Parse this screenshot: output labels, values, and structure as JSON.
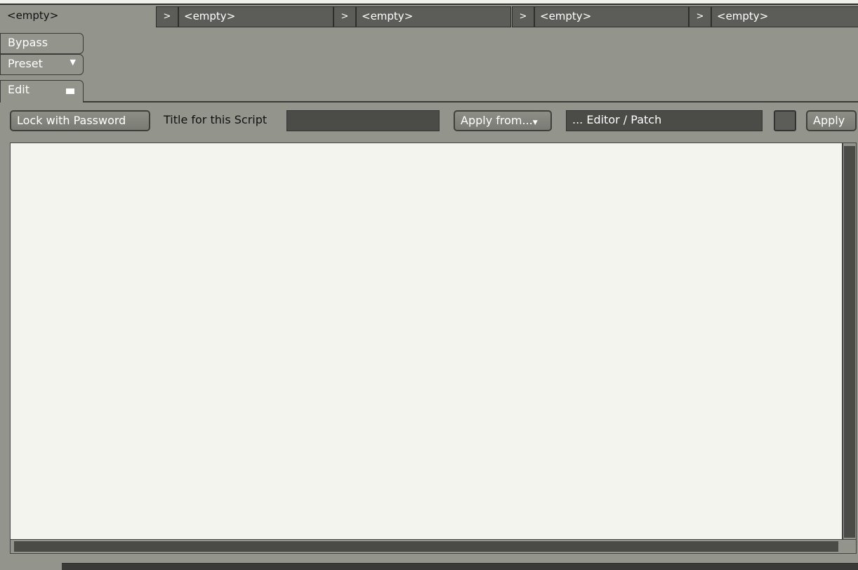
{
  "slots": [
    {
      "label": "<empty>",
      "active": true
    },
    {
      "label": "<empty>"
    },
    {
      "label": "<empty>"
    },
    {
      "label": "<empty>"
    },
    {
      "label": "<empty>"
    }
  ],
  "slot_arrow": ">",
  "side": {
    "bypass": "Bypass",
    "preset": "Preset",
    "edit": "Edit"
  },
  "toolbar": {
    "lock": "Lock with Password",
    "title_label": "Title for this Script",
    "title_value": "",
    "apply_from": "Apply from...",
    "source": "... Editor / Patch",
    "apply": "Apply"
  },
  "editor": {
    "content": ""
  },
  "colors": {
    "background": "#93948c",
    "field": "#4b4b48",
    "editor": "#f4f4ef"
  }
}
